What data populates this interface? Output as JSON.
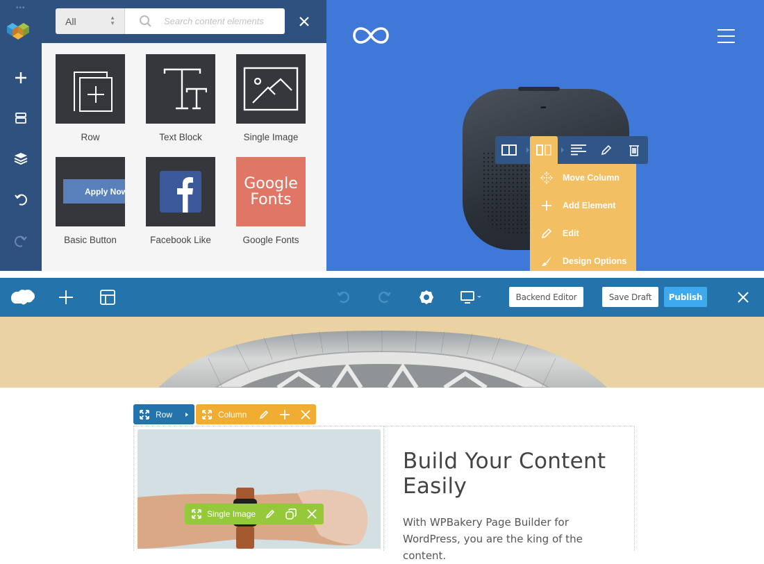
{
  "element_panel": {
    "filter": {
      "selected": "All"
    },
    "search": {
      "placeholder": "Search content elements",
      "value": ""
    },
    "elements": [
      {
        "label": "Row",
        "icon": "row-icon"
      },
      {
        "label": "Text Block",
        "icon": "text-block-icon"
      },
      {
        "label": "Single Image",
        "icon": "single-image-icon"
      },
      {
        "label": "Basic Button",
        "icon": "basic-button-icon",
        "preview_text": "Apply Now"
      },
      {
        "label": "Facebook Like",
        "icon": "facebook-icon"
      },
      {
        "label": "Google Fonts",
        "icon": "google-fonts-icon",
        "preview_text": [
          "Google",
          "Fonts"
        ]
      }
    ]
  },
  "side_rail": {
    "items": [
      "add-element",
      "templates",
      "layers",
      "undo",
      "redo"
    ]
  },
  "column_toolbar": {
    "buttons": [
      "row-layout",
      "column-layout",
      "text-align",
      "edit",
      "delete"
    ],
    "menu": [
      {
        "label": "Move Column",
        "icon": "move-icon"
      },
      {
        "label": "Add Element",
        "icon": "plus-icon"
      },
      {
        "label": "Edit",
        "icon": "pencil-icon"
      },
      {
        "label": "Design Options",
        "icon": "brush-icon"
      }
    ]
  },
  "navbar": {
    "backend_editor": "Backend Editor",
    "save_draft": "Save Draft",
    "publish": "Publish"
  },
  "controls": {
    "row": "Row",
    "column": "Column",
    "single_image": "Single Image"
  },
  "content": {
    "headline": "Build Your Content Easily",
    "body": "With WPBakery Page Builder for WordPress, you are the king of the content."
  },
  "colors": {
    "panel_blue": "#2f5180",
    "preview_blue": "#3f78d6",
    "column_yellow": "#f2c063",
    "navbar_blue": "#2473aa",
    "publish_blue": "#3fa9ed",
    "column_orange": "#f0ad32",
    "image_green": "#95c93a",
    "hero_sand": "#ead2a2",
    "google_fonts_red": "#e07665",
    "facebook_blue": "#3b5998"
  }
}
